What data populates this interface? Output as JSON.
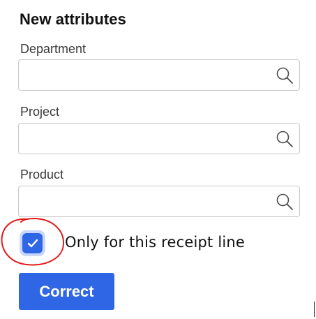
{
  "form": {
    "title": "New attributes",
    "fields": [
      {
        "label": "Department",
        "value": "",
        "placeholder": "",
        "icon": "search-icon"
      },
      {
        "label": "Project",
        "value": "",
        "placeholder": "",
        "icon": "search-icon"
      },
      {
        "label": "Product",
        "value": "",
        "placeholder": "",
        "icon": "search-icon"
      }
    ],
    "checkbox": {
      "label": "Only for this receipt line",
      "checked": true,
      "icon": "checkmark-icon"
    },
    "submit_label": "Correct"
  },
  "colors": {
    "accent": "#2f66e6",
    "checkbox_halo": "#c9d7fb",
    "annotation_circle": "#e31b1b",
    "field_border": "#c9c9c9"
  }
}
